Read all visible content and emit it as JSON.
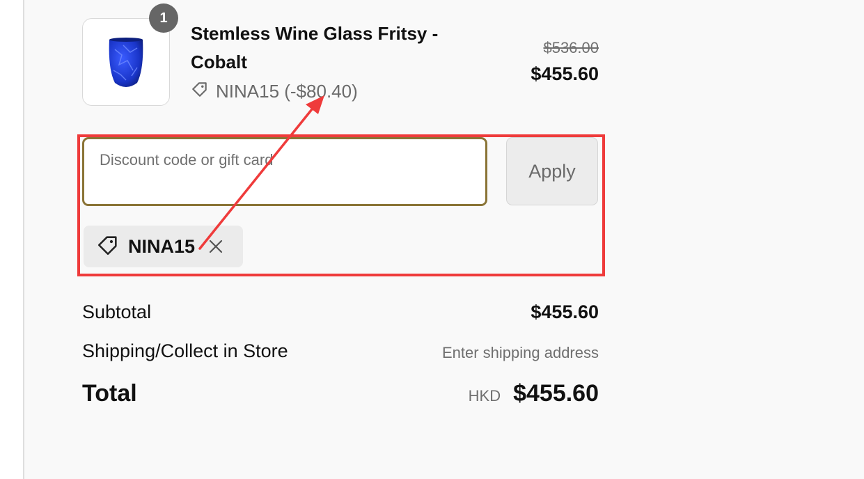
{
  "line_item": {
    "quantity": "1",
    "name": "Stemless Wine Glass Fritsy - Cobalt",
    "discount_text": "NINA15 (-$80.40)",
    "original_price": "$536.00",
    "discounted_price": "$455.60",
    "thumbnail_icon": "blue-glass-image"
  },
  "discount": {
    "placeholder": "Discount code or gift card",
    "apply_label": "Apply",
    "applied_code": "NINA15",
    "tag_icon": "tag-icon",
    "remove_icon": "close-icon"
  },
  "totals": {
    "subtotal_label": "Subtotal",
    "subtotal_value": "$455.60",
    "shipping_label": "Shipping/Collect in Store",
    "shipping_value": "Enter shipping address",
    "total_label": "Total",
    "currency": "HKD",
    "total_value": "$455.60"
  },
  "colors": {
    "highlight": "#ef3b3b",
    "input_border": "#8a7436",
    "product": "#1a35c9"
  }
}
